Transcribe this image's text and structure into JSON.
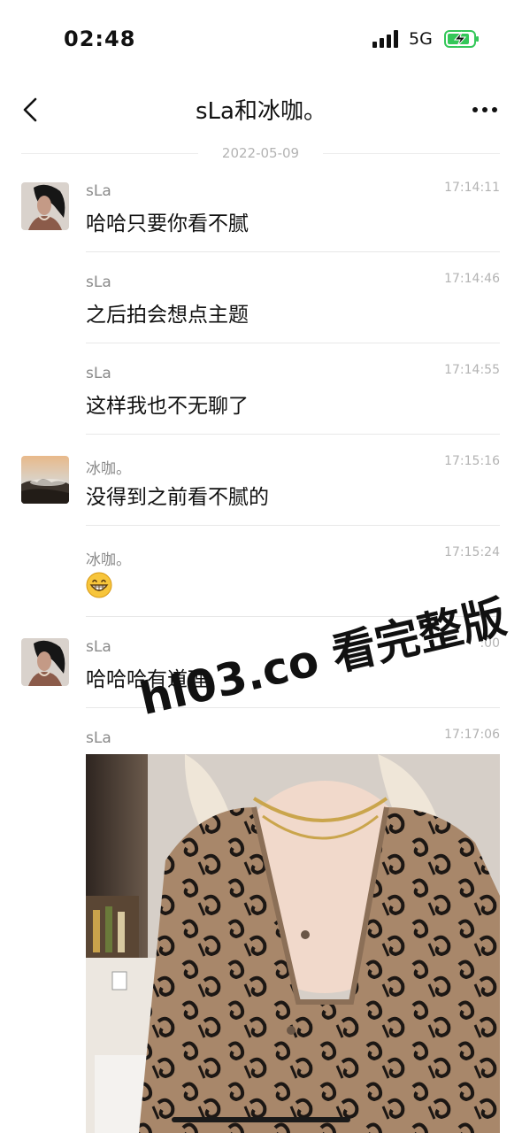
{
  "status": {
    "time": "02:48",
    "network": "5G"
  },
  "nav": {
    "title": "sLa和冰咖。"
  },
  "date_separator": "2022-05-09",
  "messages": [
    {
      "sender": "sLa",
      "time": "17:14:11",
      "text": "哈哈只要你看不腻"
    },
    {
      "sender": "sLa",
      "time": "17:14:46",
      "text": "之后拍会想点主题"
    },
    {
      "sender": "sLa",
      "time": "17:14:55",
      "text": "这样我也不无聊了"
    },
    {
      "sender": "冰咖。",
      "time": "17:15:16",
      "text": "没得到之前看不腻的"
    },
    {
      "sender": "冰咖。",
      "time": "17:15:24",
      "emoji": "grinning-face"
    },
    {
      "sender": "sLa",
      "time": ":00",
      "text": "哈哈哈有道理"
    },
    {
      "sender": "sLa",
      "time": "17:17:06",
      "image": "photo"
    }
  ],
  "watermark": "hl03.co 看完整版",
  "colors": {
    "text": "#111111",
    "meta": "#8a8a8a",
    "battery": "#34c759"
  }
}
